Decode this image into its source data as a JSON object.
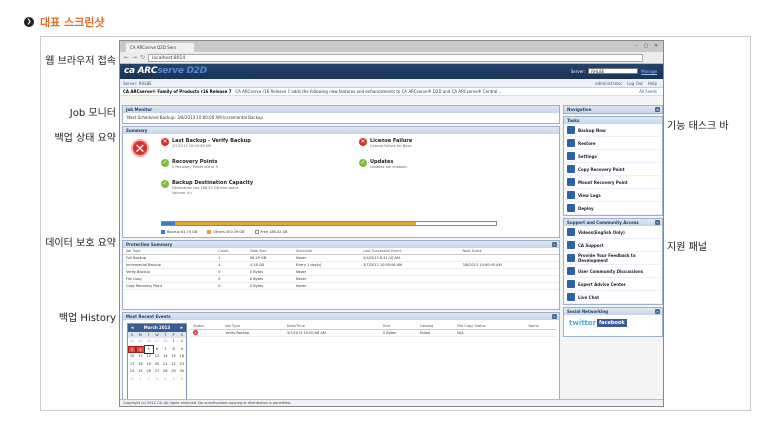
{
  "heading": {
    "bullet": "❯",
    "title": "대표 스크린샷"
  },
  "callouts": {
    "browser": "웹 브라우저 접속",
    "job_monitor": "Job 모니터",
    "backup_status": "백업 상태 요약",
    "data_protection": "데이터 보호 요약",
    "backup_history": "백업 History",
    "task_bar": "기능 태스크 바",
    "support_panel": "지원 패널"
  },
  "browser": {
    "tab_title": "CA ARCserve D2D Serv",
    "window_buttons": "– ▢ ✕",
    "url": "localhost:8014"
  },
  "app": {
    "logo_main": "ca ARC",
    "logo_sub": "serve D2D",
    "server_label": "Server:",
    "server_value": "RHL8E",
    "manage": "Manage",
    "server_sub": "Server: RHL8E",
    "admin": "administrator",
    "logout": "Log Out",
    "help": "Help",
    "release_title": "CA ARCserve® Family of Products r16 Release 7",
    "release_text": "CA ARCserve r16 Release 7 adds the following new features and enhancements to CA ARCserve® D2D and CA ARCserve® Central ...",
    "all_feeds": "All Feeds"
  },
  "job_monitor": {
    "title": "Job Monitor",
    "text": "Next Scheduled Backup: 3/8/2013 10:00:00 AM Incremental Backup"
  },
  "summary": {
    "title": "Summary",
    "last_backup": {
      "title": "Last Backup - Verify Backup",
      "sub": "3/7/2013 10:00:06 AM"
    },
    "recovery_points": {
      "title": "Recovery Points",
      "sub": "5 Recovery Points out of 5"
    },
    "destination": {
      "title": "Backup Destination Capacity",
      "sub1": "Destination has 186.02 GB free space",
      "sub2": "Volume: d:\\"
    },
    "license": {
      "title": "License Failure",
      "sub": "License Failure for Base"
    },
    "updates": {
      "title": "Updates",
      "sub": "Updates are enabled."
    },
    "capacity_backup_fraction": 0.04,
    "capacity_others_fraction": 0.72,
    "legend": {
      "backup": "Backup 61.75 GB",
      "others": "Others 400.39 GB",
      "free": "Free 186.02 GB"
    }
  },
  "protection": {
    "title": "Protection Summary",
    "headers": [
      "Job Type",
      "Count",
      "Total Size",
      "Schedule",
      "Last Successful Event",
      "Next Event"
    ],
    "rows": [
      [
        "Full Backup",
        "1",
        "56.29 GB",
        "Never",
        "2/4/2013 8:21:10 AM",
        ""
      ],
      [
        "Incremental Backup",
        "4",
        "4.16 GB",
        "Every 1 day(s)",
        "3/7/2013 10:00:06 AM",
        "3/8/2013 10:00:00 AM"
      ],
      [
        "Verify Backup",
        "0",
        "0 Bytes",
        "Never",
        "",
        ""
      ],
      [
        "File Copy",
        "0",
        "0 Bytes",
        "Never",
        "",
        ""
      ],
      [
        "Copy Recovery Point",
        "0",
        "0 Bytes",
        "Never",
        "",
        ""
      ]
    ]
  },
  "events": {
    "title": "Most Recent Events",
    "calendar": {
      "month": "March 2013",
      "dow": [
        "S",
        "M",
        "T",
        "W",
        "T",
        "F",
        "S"
      ],
      "days": [
        "24",
        "25",
        "26",
        "27",
        "28",
        "1",
        "2",
        "3",
        "4",
        "5",
        "6",
        "7",
        "8",
        "9",
        "10",
        "11",
        "12",
        "13",
        "14",
        "15",
        "16",
        "17",
        "18",
        "19",
        "20",
        "21",
        "22",
        "23",
        "24",
        "25",
        "26",
        "27",
        "28",
        "29",
        "30",
        "31",
        "1",
        "2",
        "3",
        "4",
        "5",
        "6"
      ]
    },
    "headers": [
      "Status",
      "Job Type",
      "Date/Time",
      "Size",
      "Catalog",
      "File Copy Status",
      "Name"
    ],
    "rows": [
      [
        "Verify Backup",
        "3/7/2013 10:00:06 AM",
        "0 Bytes",
        "Failed",
        "N/A",
        ""
      ]
    ]
  },
  "footer": "Copyright (c) 2012 CA. All rights reserved. No unauthorized copying or distribution is permitted.",
  "sidebar": {
    "navigation": "Navigation",
    "tasks_title": "Tasks",
    "tasks": [
      "Backup Now",
      "Restore",
      "Settings",
      "Copy Recovery Point",
      "Mount Recovery Point",
      "View Logs",
      "Deploy"
    ],
    "support_title": "Support and Community Access",
    "support": [
      "Videos(English Only)",
      "CA Support",
      "Provide Your Feedback to Development",
      "User Community Discussions",
      "Expert Advice Center",
      "Live Chat"
    ],
    "social_title": "Social Networking",
    "twitter": "twitter",
    "facebook": "facebook"
  }
}
